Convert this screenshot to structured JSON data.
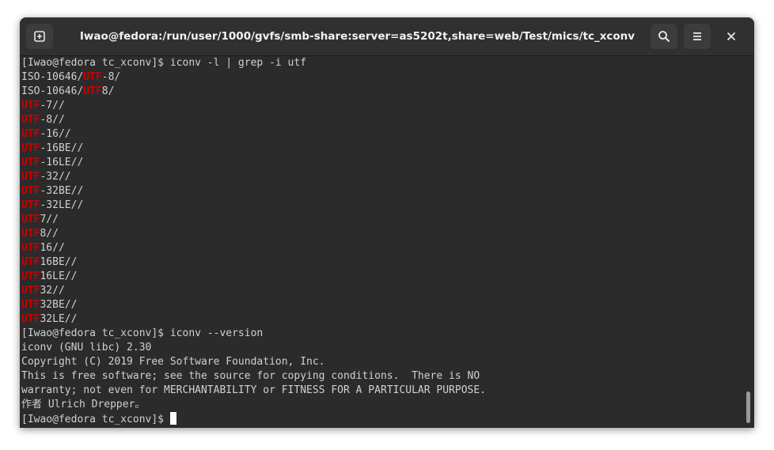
{
  "window": {
    "title": "Iwao@fedora:/run/user/1000/gvfs/smb-share:server=as5202t,share=web/Test/mics/tc_xconv"
  },
  "icons": {
    "new_tab": "new-tab-icon",
    "search": "search-icon",
    "menu": "hamburger-menu-icon",
    "close": "close-icon"
  },
  "colors": {
    "terminal_bg": "#2b2b2b",
    "terminal_fg": "#d0d0d0",
    "match_highlight": "#cc0000",
    "titlebar_bg": "#303030"
  },
  "terminal": {
    "lines": [
      [
        {
          "t": "[Iwao@fedora tc_xconv]$ iconv -l | grep -i utf"
        }
      ],
      [
        {
          "t": "ISO-10646/"
        },
        {
          "t": "UTF",
          "hl": true
        },
        {
          "t": "-8/"
        }
      ],
      [
        {
          "t": "ISO-10646/"
        },
        {
          "t": "UTF",
          "hl": true
        },
        {
          "t": "8/"
        }
      ],
      [
        {
          "t": "UTF",
          "hl": true
        },
        {
          "t": "-7//"
        }
      ],
      [
        {
          "t": "UTF",
          "hl": true
        },
        {
          "t": "-8//"
        }
      ],
      [
        {
          "t": "UTF",
          "hl": true
        },
        {
          "t": "-16//"
        }
      ],
      [
        {
          "t": "UTF",
          "hl": true
        },
        {
          "t": "-16BE//"
        }
      ],
      [
        {
          "t": "UTF",
          "hl": true
        },
        {
          "t": "-16LE//"
        }
      ],
      [
        {
          "t": "UTF",
          "hl": true
        },
        {
          "t": "-32//"
        }
      ],
      [
        {
          "t": "UTF",
          "hl": true
        },
        {
          "t": "-32BE//"
        }
      ],
      [
        {
          "t": "UTF",
          "hl": true
        },
        {
          "t": "-32LE//"
        }
      ],
      [
        {
          "t": "UTF",
          "hl": true
        },
        {
          "t": "7//"
        }
      ],
      [
        {
          "t": "UTF",
          "hl": true
        },
        {
          "t": "8//"
        }
      ],
      [
        {
          "t": "UTF",
          "hl": true
        },
        {
          "t": "16//"
        }
      ],
      [
        {
          "t": "UTF",
          "hl": true
        },
        {
          "t": "16BE//"
        }
      ],
      [
        {
          "t": "UTF",
          "hl": true
        },
        {
          "t": "16LE//"
        }
      ],
      [
        {
          "t": "UTF",
          "hl": true
        },
        {
          "t": "32//"
        }
      ],
      [
        {
          "t": "UTF",
          "hl": true
        },
        {
          "t": "32BE//"
        }
      ],
      [
        {
          "t": "UTF",
          "hl": true
        },
        {
          "t": "32LE//"
        }
      ],
      [
        {
          "t": "[Iwao@fedora tc_xconv]$ iconv --version"
        }
      ],
      [
        {
          "t": "iconv (GNU libc) 2.30"
        }
      ],
      [
        {
          "t": "Copyright (C) 2019 Free Software Foundation, Inc."
        }
      ],
      [
        {
          "t": "This is free software; see the source for copying conditions.  There is NO"
        }
      ],
      [
        {
          "t": "warranty; not even for MERCHANTABILITY or FITNESS FOR A PARTICULAR PURPOSE."
        }
      ],
      [
        {
          "t": "作者 Ulrich Drepper。"
        }
      ],
      [
        {
          "t": "[Iwao@fedora tc_xconv]$ "
        }
      ]
    ],
    "scroll_position": 1.0
  }
}
